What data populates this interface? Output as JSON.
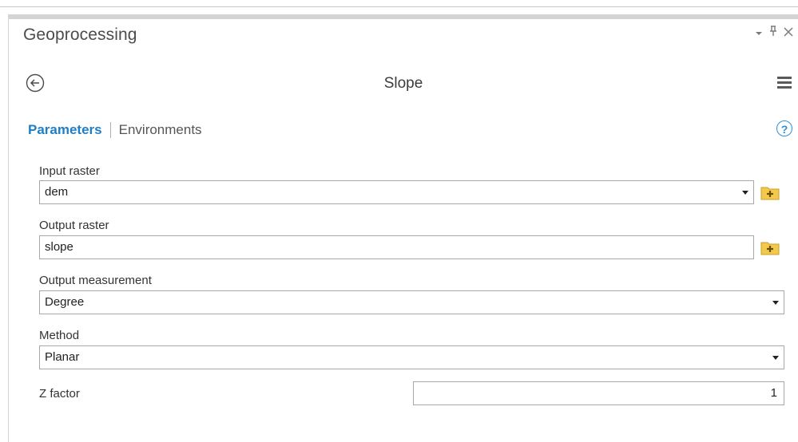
{
  "pane": {
    "title": "Geoprocessing",
    "controls": {
      "dropdown_icon": "chevron-down-icon",
      "pin_icon": "pin-icon",
      "close_icon": "close-icon"
    }
  },
  "tool": {
    "title": "Slope",
    "back_icon": "back-arrow-icon",
    "menu_icon": "hamburger-menu-icon"
  },
  "tabs": {
    "parameters": "Parameters",
    "environments": "Environments",
    "help_symbol": "?"
  },
  "params": {
    "input_raster": {
      "label": "Input raster",
      "value": "dem"
    },
    "output_raster": {
      "label": "Output raster",
      "value": "slope"
    },
    "output_measurement": {
      "label": "Output measurement",
      "value": "Degree"
    },
    "method": {
      "label": "Method",
      "value": "Planar"
    },
    "z_factor": {
      "label": "Z factor",
      "value": "1"
    }
  },
  "colors": {
    "accent": "#1f7ec5",
    "folder": "#f2c94c"
  }
}
